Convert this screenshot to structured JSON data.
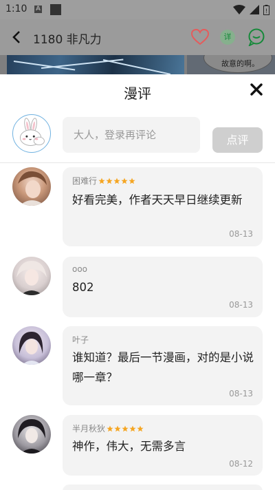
{
  "status_bar": {
    "time": "1:10",
    "notif_letter": "A"
  },
  "top_bar": {
    "title": "1180 非凡力",
    "detail_label": "详"
  },
  "manga": {
    "bubble_text": "故意的啊。"
  },
  "sheet": {
    "title": "漫评",
    "input_placeholder": "大人，登录再评论",
    "submit_label": "点评"
  },
  "comments": [
    {
      "user": "困难行",
      "stars": 5,
      "text": "好看完美，作者天天早日继续更新",
      "date": "08-13"
    },
    {
      "user": "ooo",
      "stars": 0,
      "text": "802",
      "date": "08-13"
    },
    {
      "user": "叶子",
      "stars": 0,
      "text": "谁知道？最后一节漫画，对的是小说哪一章？",
      "date": "08-13"
    },
    {
      "user": "半月秋狄",
      "stars": 5,
      "text": "神作，伟大，无需多言",
      "date": "08-12"
    }
  ],
  "colors": {
    "star": "#f5a623",
    "accent_green": "#16893a",
    "heart": "#e55b5b"
  }
}
